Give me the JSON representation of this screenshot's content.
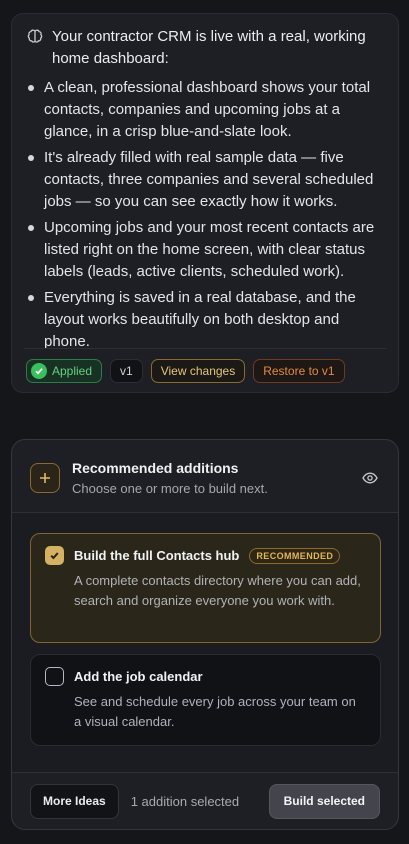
{
  "message": {
    "intro": "Your contractor CRM is live with a real, working home dashboard:",
    "bullets": [
      "A clean, professional dashboard shows your total contacts, companies and upcoming jobs at a glance, in a crisp blue-and-slate look.",
      "It's already filled with real sample data — five contacts, three companies and several scheduled jobs — so you can see exactly how it works.",
      "Upcoming jobs and your most recent contacts are listed right on the home screen, with clear status labels (leads, active clients, scheduled work).",
      "Everything is saved in a real database, and the layout works beautifully on both desktop and phone."
    ],
    "actions": {
      "applied_label": "Applied",
      "version_label": "v1",
      "view_changes_label": "View changes",
      "restore_label": "Restore to v1"
    }
  },
  "recommendations": {
    "title": "Recommended additions",
    "subtitle": "Choose one or more to build next.",
    "options": [
      {
        "title": "Build the full Contacts hub",
        "badge": "RECOMMENDED",
        "description": "A complete contacts directory where you can add, search and organize everyone you work with.",
        "checked": true
      },
      {
        "title": "Add the job calendar",
        "description": "See and schedule every job across your team on a visual calendar.",
        "checked": false
      }
    ],
    "footer": {
      "more_ideas_label": "More Ideas",
      "selection_text": "1 addition selected",
      "build_label": "Build selected"
    }
  },
  "colors": {
    "accent_gold": "#d5b163",
    "success_green": "#3bbf5e",
    "restore_orange": "#e48b3d",
    "background": "#15161a"
  }
}
